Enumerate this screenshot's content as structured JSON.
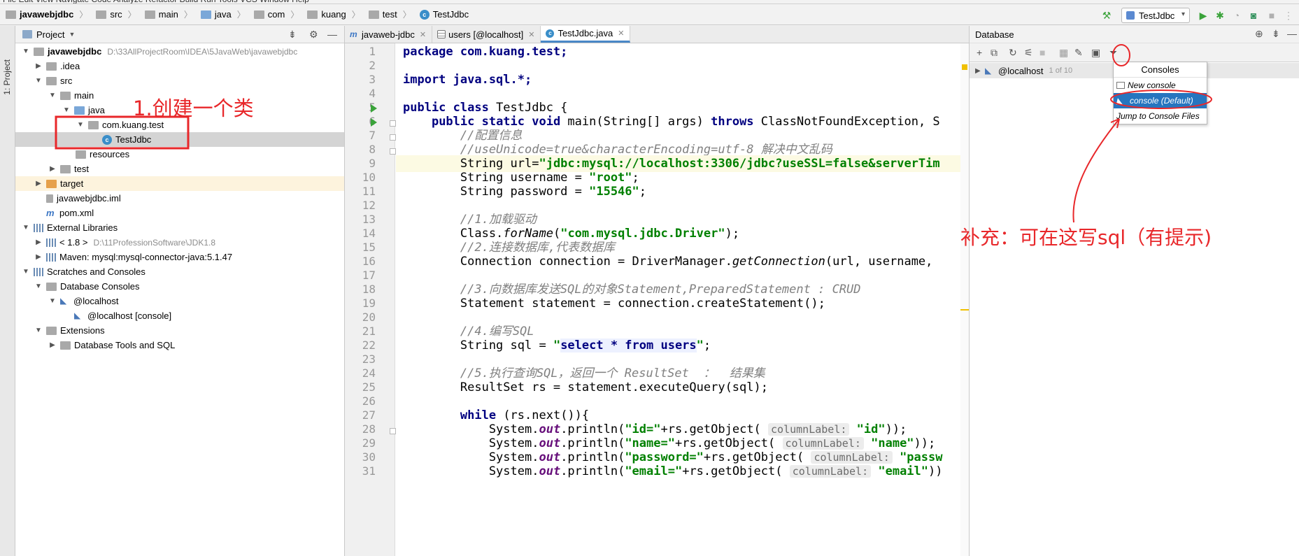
{
  "navbar": {
    "crumbs": [
      "javawebjdbc",
      "src",
      "main",
      "java",
      "com",
      "kuang",
      "test",
      "TestJdbc"
    ],
    "run_config": "TestJdbc"
  },
  "left_stripe": {
    "label": "1: Project"
  },
  "project_panel": {
    "title": "Project",
    "root_name": "javawebjdbc",
    "root_path": "D:\\33AllProjectRoom\\IDEA\\5JavaWeb\\javawebjdbc",
    "items": [
      {
        "label": ".idea"
      },
      {
        "label": "src"
      },
      {
        "label": "main"
      },
      {
        "label": "java"
      },
      {
        "label": "com.kuang.test"
      },
      {
        "label": "TestJdbc"
      },
      {
        "label": "resources"
      },
      {
        "label": "test"
      },
      {
        "label": "target"
      },
      {
        "label": "javawebjdbc.iml"
      },
      {
        "label": "pom.xml"
      },
      {
        "label": "External Libraries"
      },
      {
        "label": "< 1.8 >",
        "path": "D:\\11ProfessionSoftware\\JDK1.8"
      },
      {
        "label": "Maven: mysql:mysql-connector-java:5.1.47"
      },
      {
        "label": "Scratches and Consoles"
      },
      {
        "label": "Database Consoles"
      },
      {
        "label": "@localhost"
      },
      {
        "label": "@localhost [console]"
      },
      {
        "label": "Extensions"
      },
      {
        "label": "Database Tools and SQL"
      }
    ]
  },
  "editor": {
    "tabs": [
      {
        "label": "javaweb-jdbc"
      },
      {
        "label": "users [@localhost]"
      },
      {
        "label": "TestJdbc.java"
      }
    ],
    "line_numbers": [
      "1",
      "2",
      "3",
      "4",
      "5",
      "6",
      "7",
      "8",
      "9",
      "10",
      "11",
      "12",
      "13",
      "14",
      "15",
      "16",
      "17",
      "18",
      "19",
      "20",
      "21",
      "22",
      "23",
      "24",
      "25",
      "26",
      "27",
      "28",
      "29",
      "30",
      "31"
    ],
    "code": {
      "l1": "package com.kuang.test;",
      "l3": "import java.sql.*;",
      "l5a": "public class",
      "l5b": " TestJdbc {",
      "l6a": "    ",
      "l6b": "public static void",
      "l6c": " main(String[] args) ",
      "l6d": "throws",
      "l6e": " ClassNotFoundException, S",
      "l7": "        //配置信息",
      "l8": "        //useUnicode=true&characterEncoding=utf-8 解决中文乱码",
      "l9a": "        String url=",
      "l9b": "\"jdbc:mysql://localhost:3306/jdbc?useSSL=false&serverTim",
      "l10a": "        String username = ",
      "l10b": "\"root\"",
      "l10c": ";",
      "l11a": "        String password = ",
      "l11b": "\"15546\"",
      "l11c": ";",
      "l13": "        //1.加载驱动",
      "l14a": "        Class.",
      "l14b": "forName",
      "l14c": "(",
      "l14d": "\"com.mysql.jdbc.Driver\"",
      "l14e": ");",
      "l15": "        //2.连接数据库,代表数据库",
      "l16a": "        Connection connection = DriverManager.",
      "l16b": "getConnection",
      "l16c": "(url, username,",
      "l18": "        //3.向数据库发送SQL的对象Statement,PreparedStatement : CRUD",
      "l19": "        Statement statement = connection.createStatement();",
      "l21": "        //4.编写SQL",
      "l22a": "        String sql = ",
      "l22b": "\"",
      "l22c": "select * from users",
      "l22d": "\"",
      "l22e": ";",
      "l24": "        //5.执行查询SQL，返回一个 ResultSet  ：  结果集",
      "l25": "        ResultSet rs = statement.executeQuery(sql);",
      "l27a": "        ",
      "l27b": "while",
      "l27c": " (rs.next()){",
      "l28a": "            System.",
      "l28b": "out",
      "l28c": ".println(",
      "l28d": "\"id=\"",
      "l28e": "+rs.getObject( ",
      "l28f": "columnLabel:",
      "l28g": " ",
      "l28h": "\"id\"",
      "l28i": "));",
      "l29a": "            System.",
      "l29b": "out",
      "l29c": ".println(",
      "l29d": "\"name=\"",
      "l29e": "+rs.getObject( ",
      "l29f": "columnLabel:",
      "l29g": " ",
      "l29h": "\"name\"",
      "l29i": "));",
      "l30a": "            System.",
      "l30b": "out",
      "l30c": ".println(",
      "l30d": "\"password=\"",
      "l30e": "+rs.getObject( ",
      "l30f": "columnLabel:",
      "l30g": " ",
      "l30h": "\"passw",
      "l31a": "            System.",
      "l31b": "out",
      "l31c": ".println(",
      "l31d": "\"email=\"",
      "l31e": "+rs.getObject( ",
      "l31f": "columnLabel:",
      "l31g": " ",
      "l31h": "\"email\"",
      "l31i": "))"
    }
  },
  "database_panel": {
    "title": "Database",
    "connection": "@localhost",
    "count": "1 of 10",
    "popup": {
      "title": "Consoles",
      "items": [
        "New console",
        "console (Default)",
        "Jump to Console Files"
      ]
    }
  },
  "annotations": {
    "create_class": "1.创建一个类",
    "supplement": "补充：可在这写sql（有提示)"
  },
  "colors": {
    "annotation": "#e8272a",
    "keyword": "#000080",
    "string": "#008000",
    "comment": "#808080",
    "selection": "#2675bf"
  }
}
